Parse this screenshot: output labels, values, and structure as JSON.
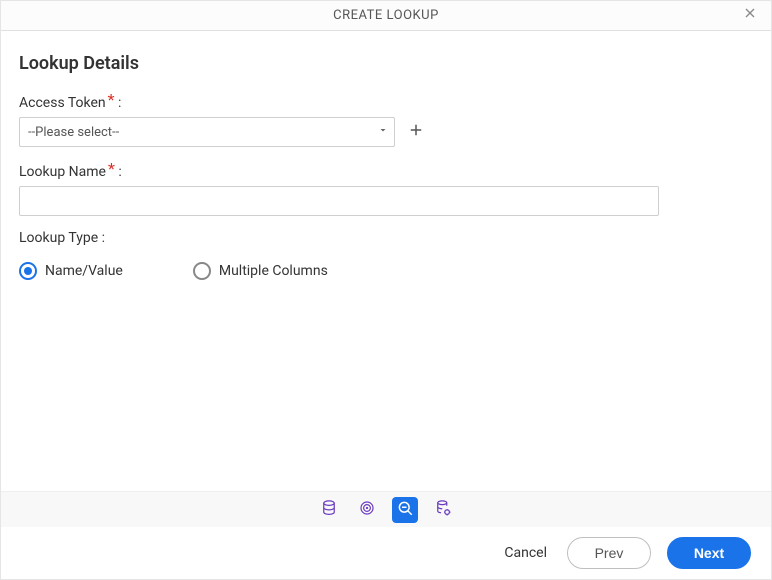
{
  "header": {
    "title": "CREATE LOOKUP"
  },
  "section": {
    "title": "Lookup Details"
  },
  "form": {
    "access_token": {
      "label": "Access Token",
      "select_value": "--Please select--"
    },
    "lookup_name": {
      "label": "Lookup Name",
      "value": ""
    },
    "lookup_type": {
      "label": "Lookup Type",
      "options": {
        "name_value": "Name/Value",
        "multiple_columns": "Multiple Columns"
      },
      "selected": "name_value"
    }
  },
  "steps": {
    "s1": "database-icon",
    "s2": "target-icon",
    "s3": "search-zoom-icon",
    "s4": "database-gear-icon"
  },
  "footer": {
    "cancel": "Cancel",
    "prev": "Prev",
    "next": "Next"
  }
}
